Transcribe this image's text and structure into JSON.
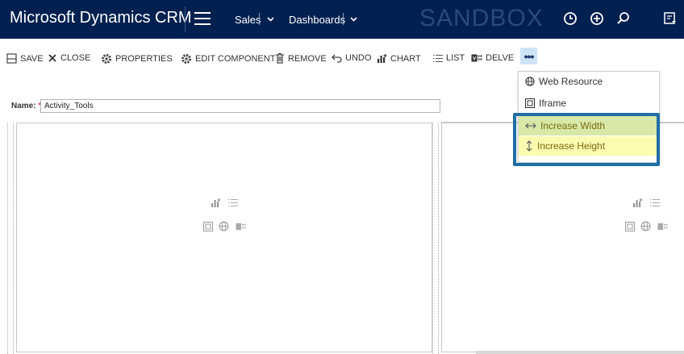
{
  "header": {
    "app_title": "Microsoft Dynamics CRM",
    "nav_area": "Sales",
    "nav_page": "Dashboards",
    "environment": "SANDBOX",
    "icons": [
      "history-icon",
      "new-icon",
      "search-icon",
      "advanced-find-icon"
    ]
  },
  "toolbar": {
    "save": "SAVE",
    "close": "CLOSE",
    "properties": "PROPERTIES",
    "edit_component": "EDIT COMPONENT",
    "remove": "REMOVE",
    "undo": "UNDO",
    "chart": "CHART",
    "list": "LIST",
    "delve": "DELVE",
    "more": "•••"
  },
  "overflow_menu": {
    "items": [
      {
        "label": "Web Resource",
        "icon": "globe-icon"
      },
      {
        "label": "Iframe",
        "icon": "iframe-icon"
      },
      {
        "label": "Increase Width",
        "icon": "width-arrows-icon"
      },
      {
        "label": "Increase Height",
        "icon": "height-arrows-icon"
      }
    ],
    "colors": {
      "increase_width_bg": "#d7e8a7",
      "increase_height_bg": "#fdfbb0",
      "callout_border": "#1f6ea5"
    }
  },
  "form": {
    "name_label": "Name:",
    "required_marker": "*",
    "name_value": "Activity_Tools"
  },
  "colors": {
    "header_bg": "#002050",
    "accent": "#1f6ea5"
  }
}
